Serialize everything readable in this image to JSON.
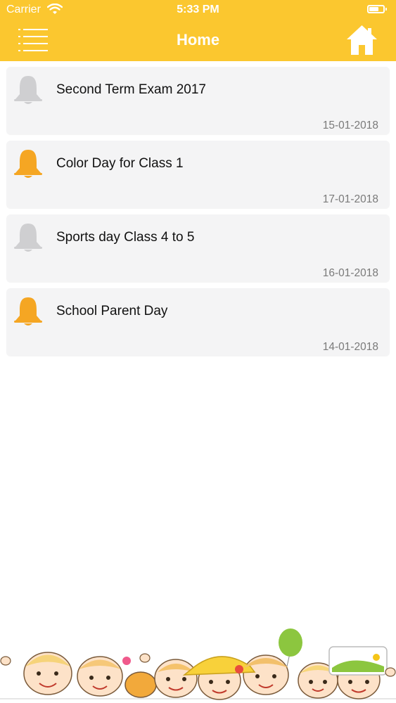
{
  "status_bar": {
    "carrier": "Carrier",
    "time": "5:33 PM",
    "battery_level": 0.7
  },
  "header": {
    "title": "Home",
    "background": "#fbc72f",
    "menu_icon": "menu-icon",
    "home_icon": "home-icon"
  },
  "colors": {
    "bell_active": "#f5a623",
    "bell_inactive": "#cfcfd1"
  },
  "notices": [
    {
      "title": "Second Term Exam 2017",
      "date": "15-01-2018",
      "bell": "inactive"
    },
    {
      "title": "Color Day for Class 1",
      "date": "17-01-2018",
      "bell": "active"
    },
    {
      "title": "Sports day Class 4 to 5",
      "date": "16-01-2018",
      "bell": "inactive"
    },
    {
      "title": "School Parent Day",
      "date": "14-01-2018",
      "bell": "active"
    }
  ]
}
